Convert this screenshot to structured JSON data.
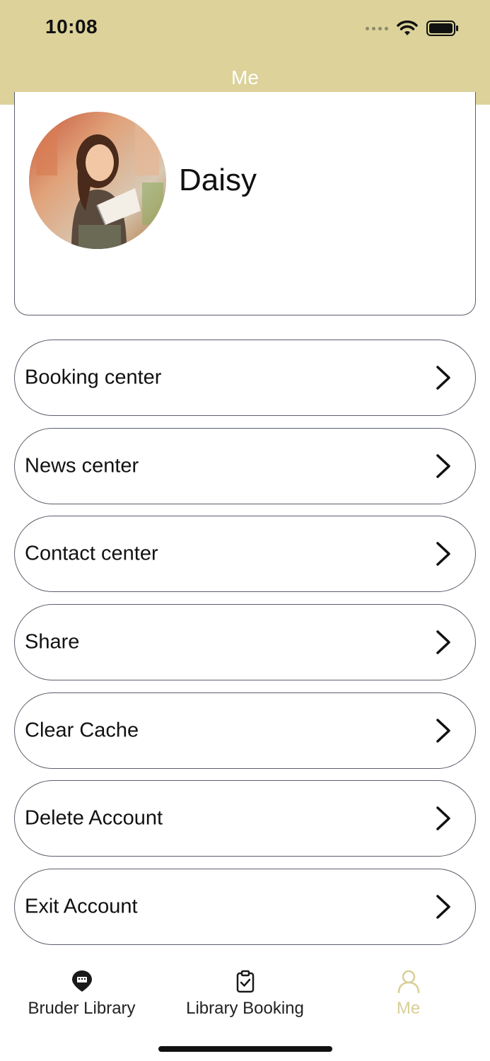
{
  "status_bar": {
    "time": "10:08"
  },
  "nav": {
    "title": "Me"
  },
  "profile": {
    "name": "Daisy"
  },
  "menu": [
    {
      "label": "Booking center"
    },
    {
      "label": "News center"
    },
    {
      "label": "Contact center"
    },
    {
      "label": "Share"
    },
    {
      "label": "Clear Cache"
    },
    {
      "label": "Delete Account"
    },
    {
      "label": "Exit Account"
    }
  ],
  "tabs": [
    {
      "label": "Bruder Library",
      "icon": "location-pin-icon"
    },
    {
      "label": "Library Booking",
      "icon": "clipboard-check-icon"
    },
    {
      "label": "Me",
      "icon": "person-icon",
      "active": true
    }
  ],
  "colors": {
    "header": "#dcd29a",
    "active_tab": "#d8cf98",
    "border": "#5a5f6b"
  }
}
